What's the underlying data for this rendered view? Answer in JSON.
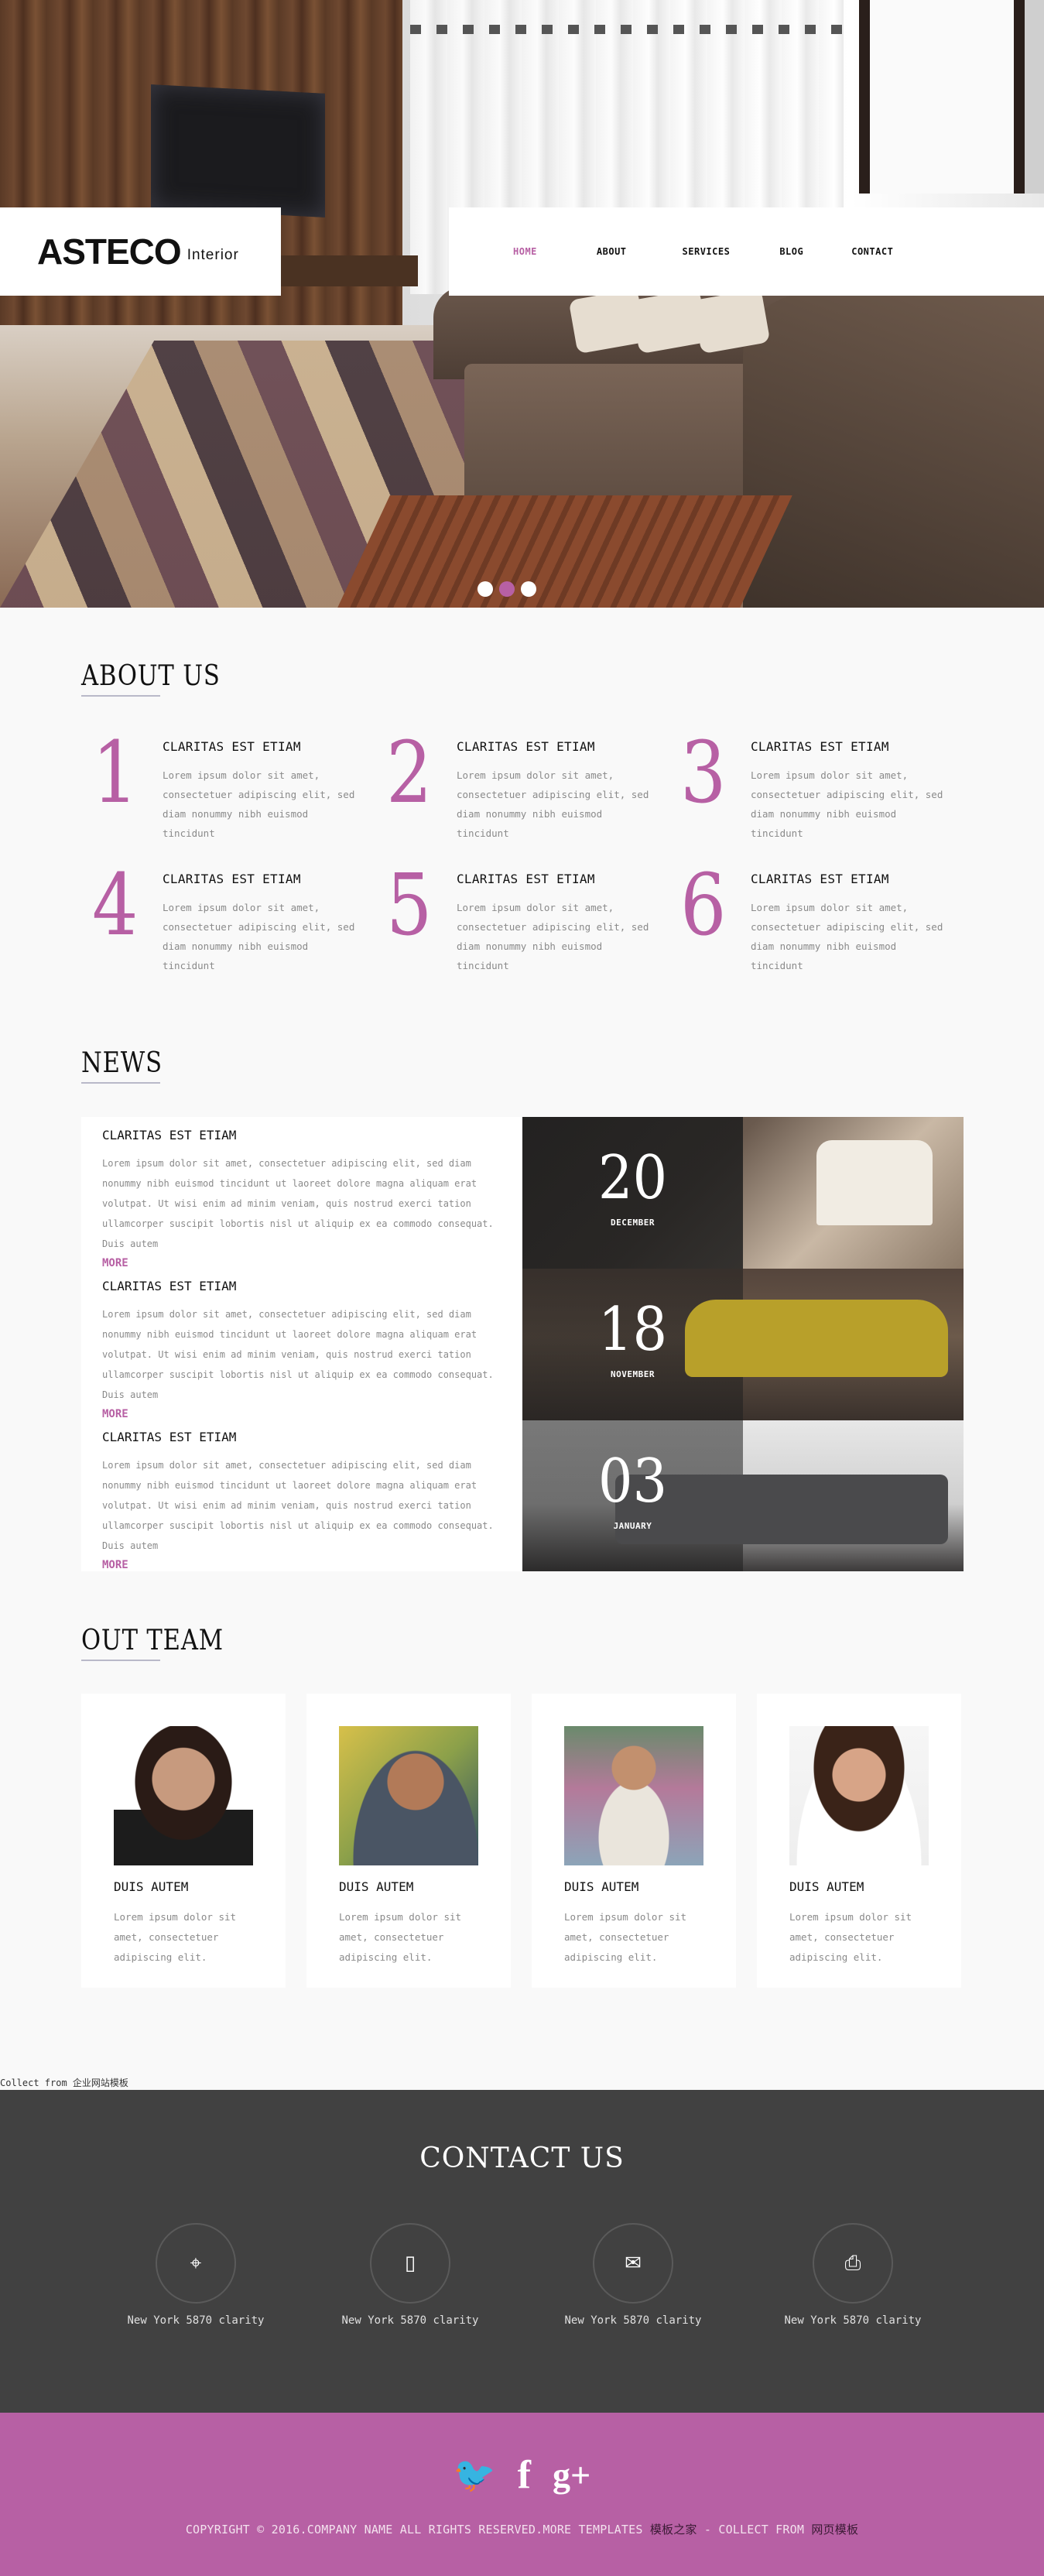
{
  "brand": {
    "name": "ASTECO",
    "tagline": "Interior"
  },
  "nav": [
    {
      "label": "HOME",
      "active": true
    },
    {
      "label": "ABOUT"
    },
    {
      "label": "SERVICES"
    },
    {
      "label": "BLOG"
    },
    {
      "label": "CONTACT"
    }
  ],
  "slider": {
    "slides": 3,
    "active_index": 1
  },
  "about": {
    "title": "ABOUT US",
    "items": [
      {
        "num": "1",
        "heading": "CLARITAS EST ETIAM",
        "text": "Lorem ipsum dolor sit amet, consectetuer adipiscing elit, sed diam nonummy nibh euismod tincidunt"
      },
      {
        "num": "2",
        "heading": "CLARITAS EST ETIAM",
        "text": "Lorem ipsum dolor sit amet, consectetuer adipiscing elit, sed diam nonummy nibh euismod tincidunt"
      },
      {
        "num": "3",
        "heading": "CLARITAS EST ETIAM",
        "text": "Lorem ipsum dolor sit amet, consectetuer adipiscing elit, sed diam nonummy nibh euismod tincidunt"
      },
      {
        "num": "4",
        "heading": "CLARITAS EST ETIAM",
        "text": "Lorem ipsum dolor sit amet, consectetuer adipiscing elit, sed diam nonummy nibh euismod tincidunt"
      },
      {
        "num": "5",
        "heading": "CLARITAS EST ETIAM",
        "text": "Lorem ipsum dolor sit amet, consectetuer adipiscing elit, sed diam nonummy nibh euismod tincidunt"
      },
      {
        "num": "6",
        "heading": "CLARITAS EST ETIAM",
        "text": "Lorem ipsum dolor sit amet, consectetuer adipiscing elit, sed diam nonummy nibh euismod tincidunt"
      }
    ]
  },
  "news": {
    "title": "NEWS",
    "items": [
      {
        "heading": "CLARITAS EST ETIAM",
        "text": "Lorem ipsum dolor sit amet, consectetuer adipiscing elit, sed diam nonummy nibh euismod tincidunt ut laoreet dolore magna aliquam erat volutpat. Ut wisi enim ad minim veniam, quis nostrud exerci tation ullamcorper suscipit lobortis nisl ut aliquip ex ea commodo consequat. Duis autem",
        "more": "MORE",
        "day": "20",
        "month": "DECEMBER"
      },
      {
        "heading": "CLARITAS EST ETIAM",
        "text": "Lorem ipsum dolor sit amet, consectetuer adipiscing elit, sed diam nonummy nibh euismod tincidunt ut laoreet dolore magna aliquam erat volutpat. Ut wisi enim ad minim veniam, quis nostrud exerci tation ullamcorper suscipit lobortis nisl ut aliquip ex ea commodo consequat. Duis autem",
        "more": "MORE",
        "day": "18",
        "month": "NOVEMBER"
      },
      {
        "heading": "CLARITAS EST ETIAM",
        "text": "Lorem ipsum dolor sit amet, consectetuer adipiscing elit, sed diam nonummy nibh euismod tincidunt ut laoreet dolore magna aliquam erat volutpat. Ut wisi enim ad minim veniam, quis nostrud exerci tation ullamcorper suscipit lobortis nisl ut aliquip ex ea commodo consequat. Duis autem",
        "more": "MORE",
        "day": "03",
        "month": "JANUARY"
      }
    ]
  },
  "team": {
    "title": "OUT TEAM",
    "members": [
      {
        "name": "DUIS AUTEM",
        "text": "Lorem ipsum dolor sit amet, consectetuer adipiscing elit."
      },
      {
        "name": "DUIS AUTEM",
        "text": "Lorem ipsum dolor sit amet, consectetuer adipiscing elit."
      },
      {
        "name": "DUIS AUTEM",
        "text": "Lorem ipsum dolor sit amet, consectetuer adipiscing elit."
      },
      {
        "name": "DUIS AUTEM",
        "text": "Lorem ipsum dolor sit amet, consectetuer adipiscing elit."
      }
    ]
  },
  "collect_note": "Collect from 企业网站模板",
  "contact": {
    "title": "CONTACT US",
    "items": [
      {
        "icon": "map-pin-icon",
        "glyph": "⌖",
        "label": "New York 5870 clarity"
      },
      {
        "icon": "phone-icon",
        "glyph": "▯",
        "label": "New York 5870 clarity"
      },
      {
        "icon": "mail-icon",
        "glyph": "✉",
        "label": "New York 5870 clarity"
      },
      {
        "icon": "printer-icon",
        "glyph": "⎙",
        "label": "New York 5870 clarity"
      }
    ]
  },
  "footer": {
    "social": [
      {
        "icon": "twitter-icon",
        "glyph": "🐦"
      },
      {
        "icon": "facebook-icon",
        "glyph": "f"
      },
      {
        "icon": "google-plus-icon",
        "glyph": "g+"
      }
    ],
    "copyright": "COPYRIGHT © 2016.COMPANY NAME ALL RIGHTS RESERVED.MORE TEMPLATES ",
    "link1": "模板之家",
    "middle": " - COLLECT FROM ",
    "link2": "网页模板"
  },
  "colors": {
    "accent": "#b760a4",
    "contact_bg": "#414141",
    "page_bg": "#f9f9f9"
  }
}
